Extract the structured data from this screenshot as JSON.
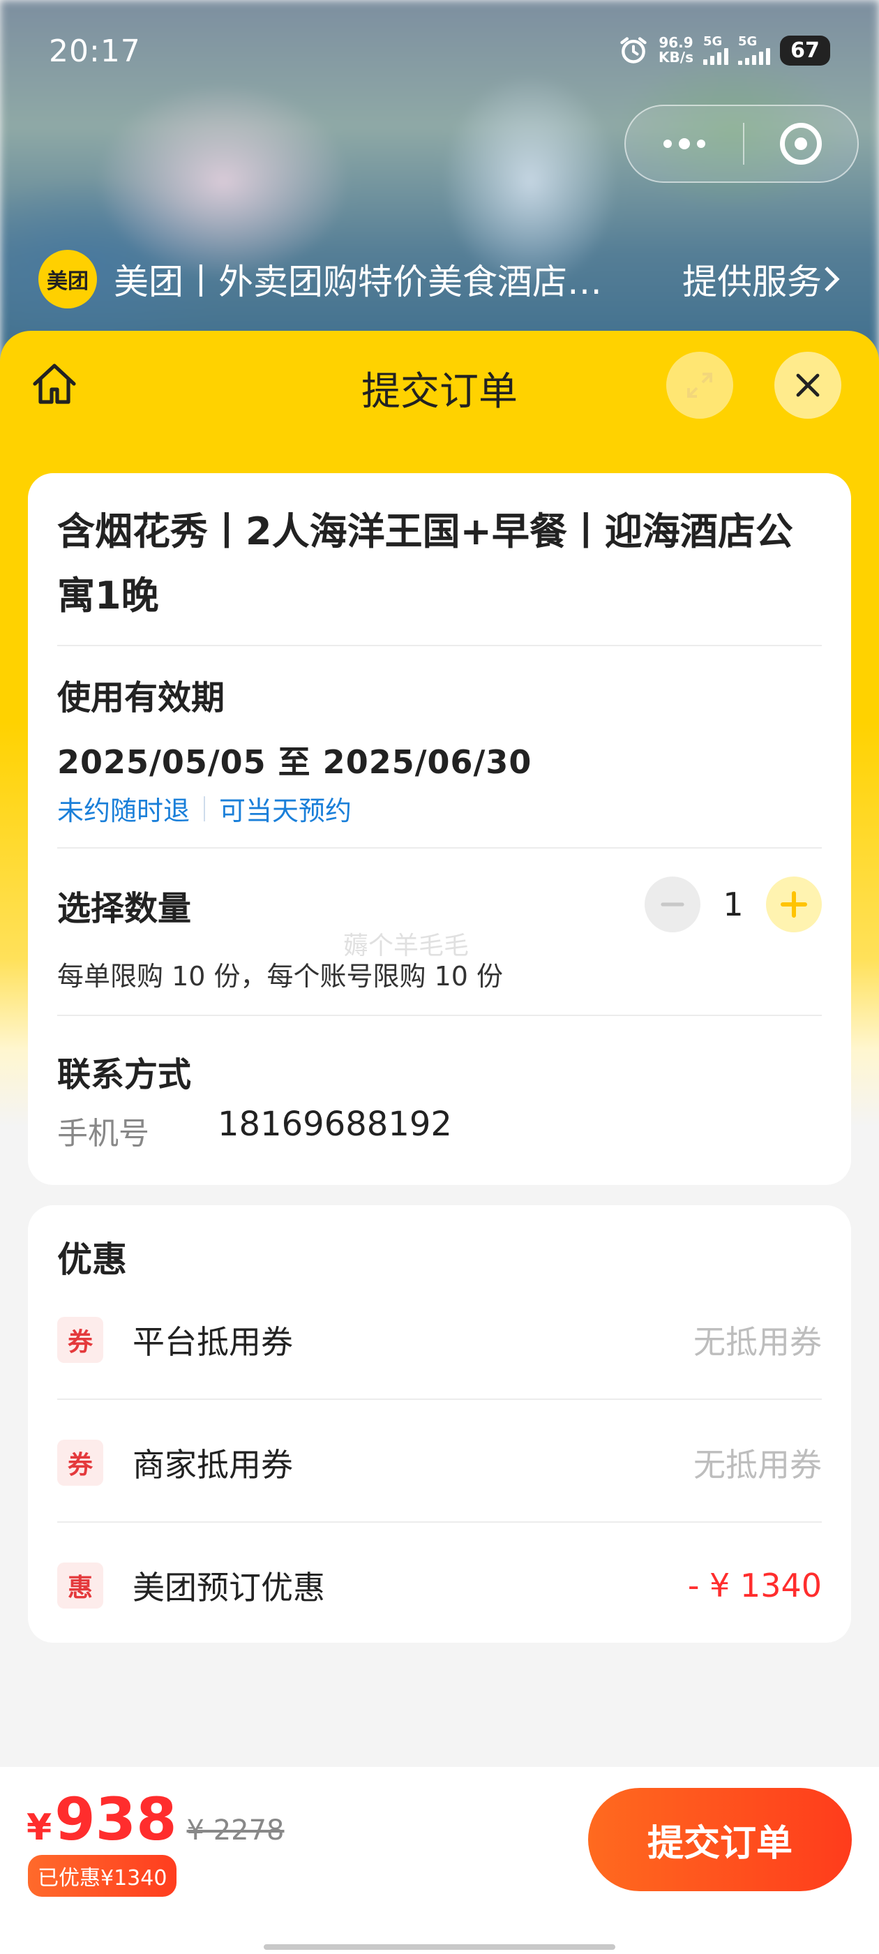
{
  "status_bar": {
    "time": "20:17",
    "net_speed_value": "96.9",
    "net_speed_unit": "KB/s",
    "sim1": "5G",
    "sim2": "5G",
    "battery": "67"
  },
  "mini_program": {
    "logo_text": "美团",
    "name": "美团丨外卖团购特价美食酒店…",
    "service_link": "提供服务"
  },
  "header": {
    "title": "提交订单"
  },
  "product": {
    "title": "含烟花秀丨2人海洋王国+早餐丨迎海酒店公寓1晚"
  },
  "validity": {
    "heading": "使用有效期",
    "dates": "2025/05/05 至 2025/06/30",
    "tags": [
      "未约随时退",
      "可当天预约"
    ]
  },
  "quantity": {
    "heading": "选择数量",
    "value": "1",
    "limit_text": "每单限购 10 份，每个账号限购 10 份",
    "watermark": "薅个羊毛毛"
  },
  "contact": {
    "heading": "联系方式",
    "phone_label": "手机号",
    "phone_value": "18169688192"
  },
  "discounts": {
    "heading": "优惠",
    "items": [
      {
        "icon": "券",
        "label": "平台抵用券",
        "value": "无抵用券"
      },
      {
        "icon": "券",
        "label": "商家抵用券",
        "value": "无抵用券"
      },
      {
        "icon": "惠",
        "label": "美团预订优惠",
        "value": "- ¥ 1340"
      }
    ]
  },
  "footer": {
    "currency": "¥",
    "price": "938",
    "original_price": "¥ 2278",
    "saved_text": "已优惠¥1340",
    "submit_label": "提交订单"
  },
  "colors": {
    "brand_yellow": "#ffd200",
    "price_red": "#ff2d2d",
    "link_blue": "#1a7fd9",
    "cta_orange": "#ff5a1f"
  }
}
